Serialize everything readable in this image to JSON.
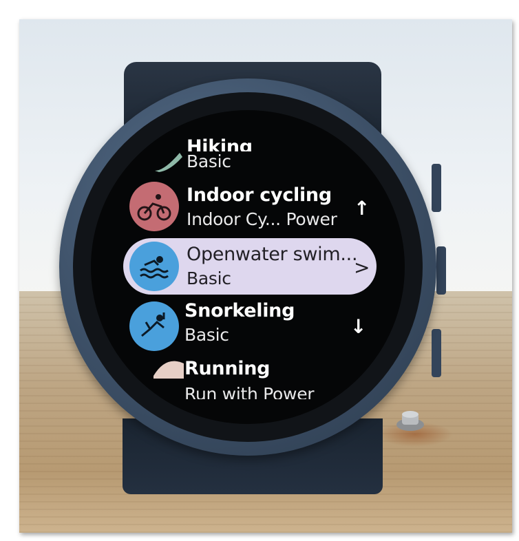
{
  "watch": {
    "activities": [
      {
        "title": "Hiking",
        "subtitle": "Basic",
        "icon": "hiking-icon",
        "color": "#8fb9a8"
      },
      {
        "title": "Indoor cycling",
        "subtitle": "Indoor Cy... Power",
        "icon": "cycling-icon",
        "color": "#c46c73"
      },
      {
        "title": "Openwater swim...",
        "subtitle": "Basic",
        "icon": "swimming-icon",
        "color": "#4aa0dc",
        "selected": true
      },
      {
        "title": "Snorkeling",
        "subtitle": "Basic",
        "icon": "snorkeling-icon",
        "color": "#4aa0dc"
      },
      {
        "title": "Running",
        "subtitle": "Run with Power",
        "icon": "running-icon",
        "color": "#e6cfc6"
      }
    ],
    "scroll_up_icon": "↑",
    "scroll_down_icon": "↓",
    "select_icon": ">"
  }
}
